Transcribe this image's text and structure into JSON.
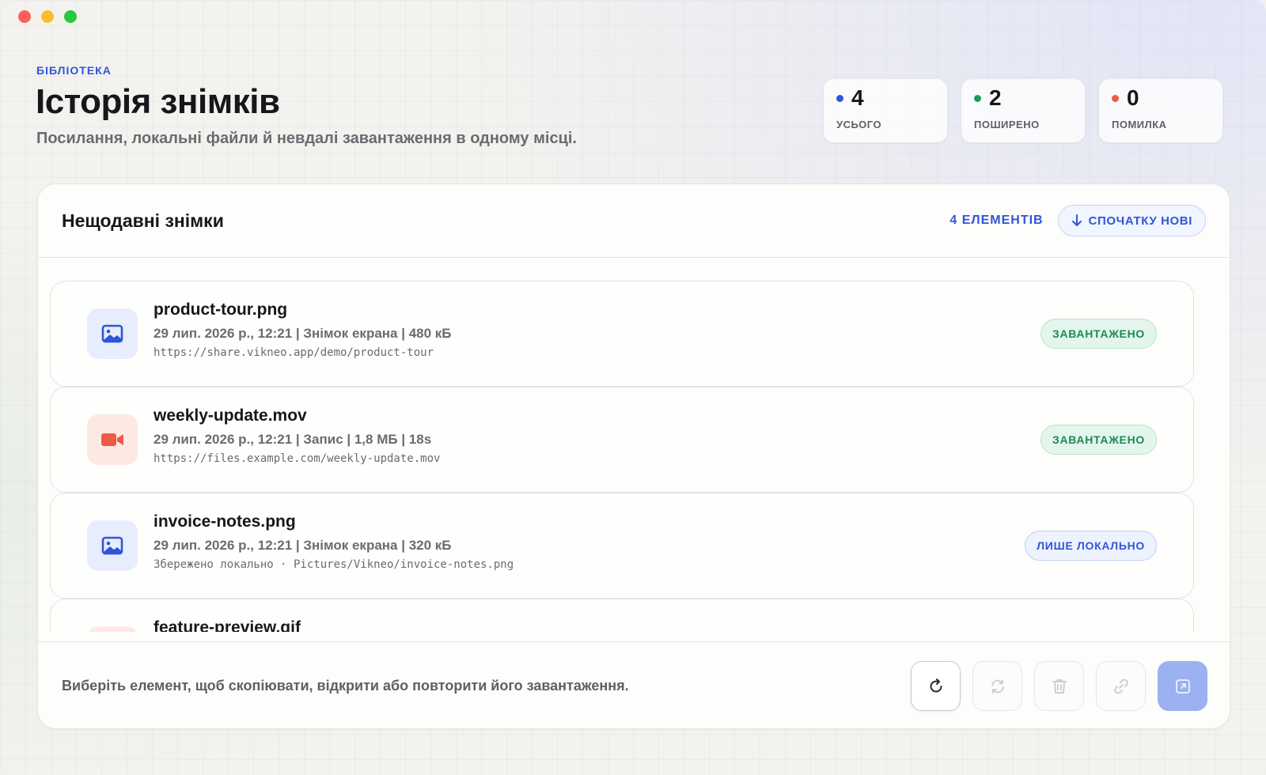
{
  "header": {
    "eyebrow": "БІБЛІОТЕКА",
    "title": "Історія знімків",
    "subtitle": "Посилання, локальні файли й невдалі завантаження в одному місці."
  },
  "stats": [
    {
      "value": "4",
      "label": "УСЬОГО",
      "color": "#2f56d6"
    },
    {
      "value": "2",
      "label": "ПОШИРЕНО",
      "color": "#1d9a5f"
    },
    {
      "value": "0",
      "label": "ПОМИЛКА",
      "color": "#ef5a45"
    }
  ],
  "panel": {
    "title": "Нещодавні знімки",
    "count_label": "4 ЕЛЕМЕНТІВ",
    "sort_label": "СПОЧАТКУ НОВІ"
  },
  "items": [
    {
      "name": "product-tour.png",
      "meta": "29 лип. 2026 р., 12:21  |  Знімок екрана  |  480 кБ",
      "url": "https://share.vikneo.app/demo/product-tour",
      "icon": "image-icon",
      "status": "ЗАВАНТАЖЕНО",
      "status_color": "#1d8a55"
    },
    {
      "name": "weekly-update.mov",
      "meta": "29 лип. 2026 р., 12:21  |  Запис  |  1,8 МБ  |  18s",
      "url": "https://files.example.com/weekly-update.mov",
      "icon": "video-camera-icon",
      "status": "ЗАВАНТАЖЕНО",
      "status_color": "#1d8a55"
    },
    {
      "name": "invoice-notes.png",
      "meta": "29 лип. 2026 р., 12:21  |  Знімок екрана  |  320 кБ",
      "url": "Збережено локально  ·  Pictures/Vikneo/invoice-notes.png",
      "icon": "image-icon",
      "status": "ЛИШЕ ЛОКАЛЬНО",
      "status_color": "#2f56d6"
    },
    {
      "name": "feature-preview.gif",
      "icon": "video-camera-icon"
    }
  ],
  "footer": {
    "hint": "Виберіть елемент, щоб скопіювати, відкрити або повторити його завантаження.",
    "actions": [
      "refresh-icon",
      "retry-upload-icon",
      "trash-icon",
      "link-icon",
      "open-external-icon"
    ]
  }
}
